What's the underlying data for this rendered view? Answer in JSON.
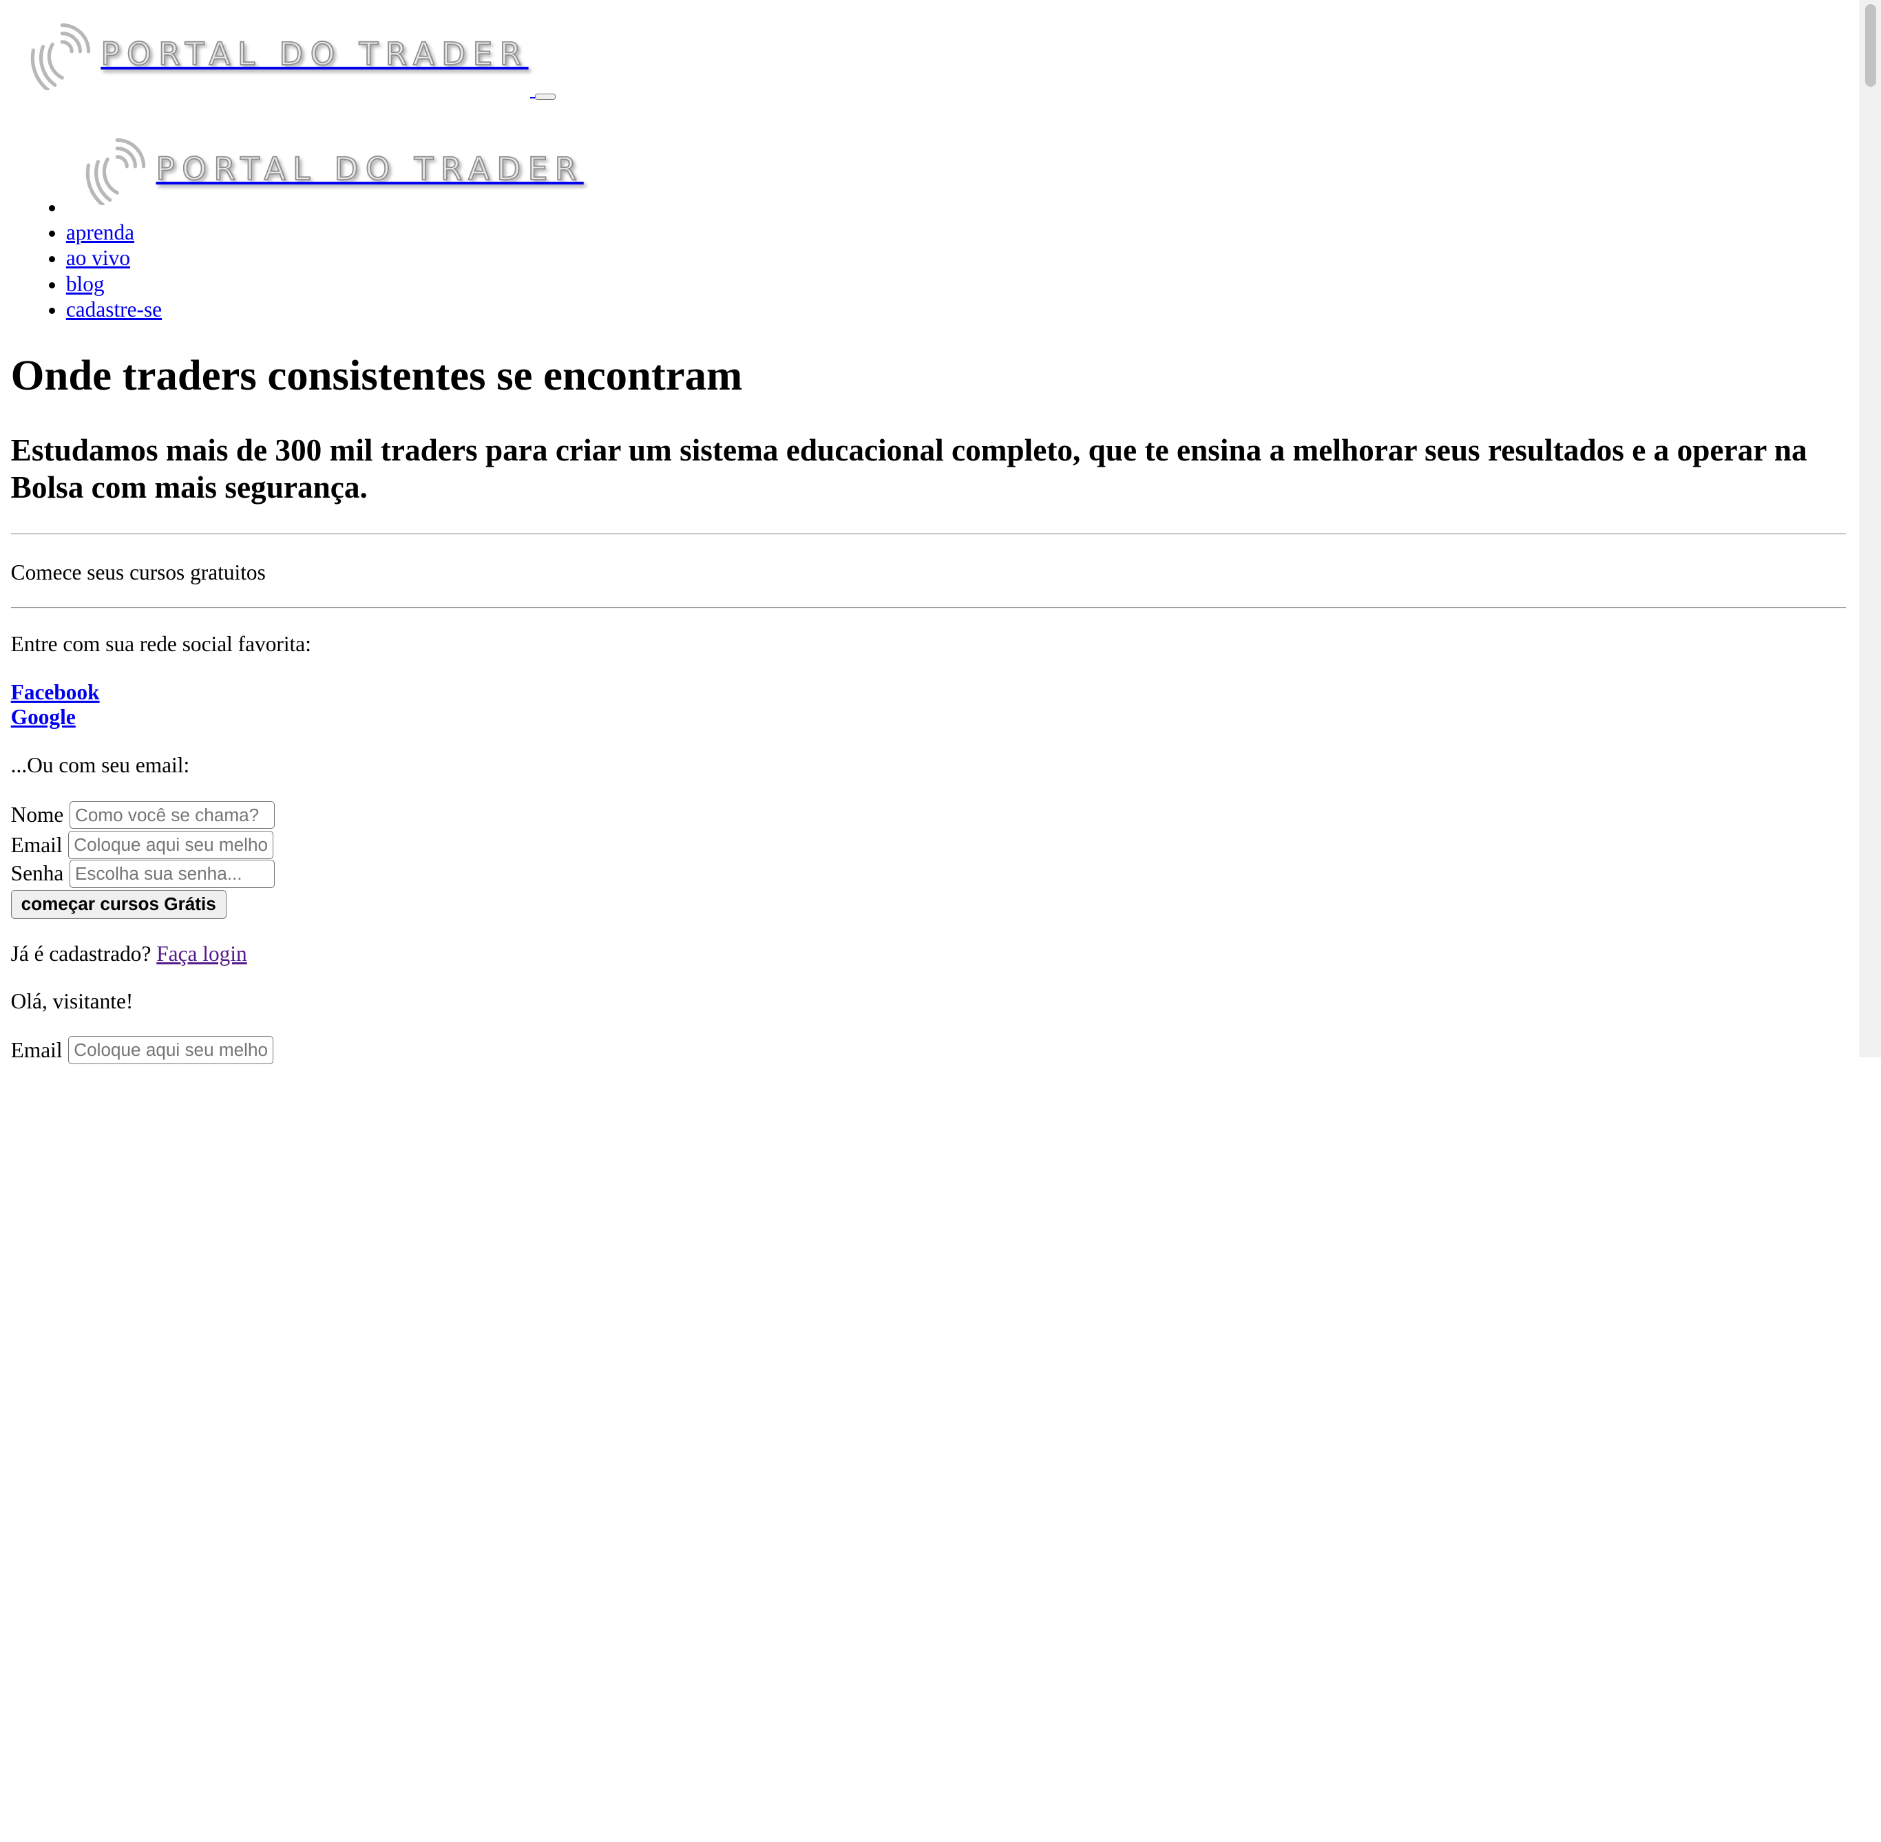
{
  "brand": {
    "logo_text": "PORTAL DO TRADER"
  },
  "nav": {
    "items": [
      "aprenda",
      "ao vivo",
      "blog",
      "cadastre-se"
    ]
  },
  "hero": {
    "title": "Onde traders consistentes se encontram",
    "subtitle": "Estudamos mais de 300 mil traders para criar um sistema educacional completo, que te ensina a melhorar seus resultados e a operar na Bolsa com mais segurança."
  },
  "signup": {
    "section_label": "Comece seus cursos gratuitos",
    "social_prompt": "Entre com sua rede social favorita:",
    "facebook": "Facebook",
    "google": "Google",
    "email_prompt": "...Ou com seu email:",
    "name_label": "Nome",
    "name_placeholder": "Como você se chama?",
    "email_label": "Email",
    "email_placeholder": "Coloque aqui seu melhor email...",
    "password_label": "Senha",
    "password_placeholder": "Escolha sua senha...",
    "submit_label": "começar cursos Grátis",
    "already_text": "Já é cadastrado?",
    "login_link": "Faça login"
  },
  "login": {
    "greeting": "Olá, visitante!",
    "email_label": "Email",
    "email_placeholder": "Coloque aqui seu melhor email..."
  }
}
